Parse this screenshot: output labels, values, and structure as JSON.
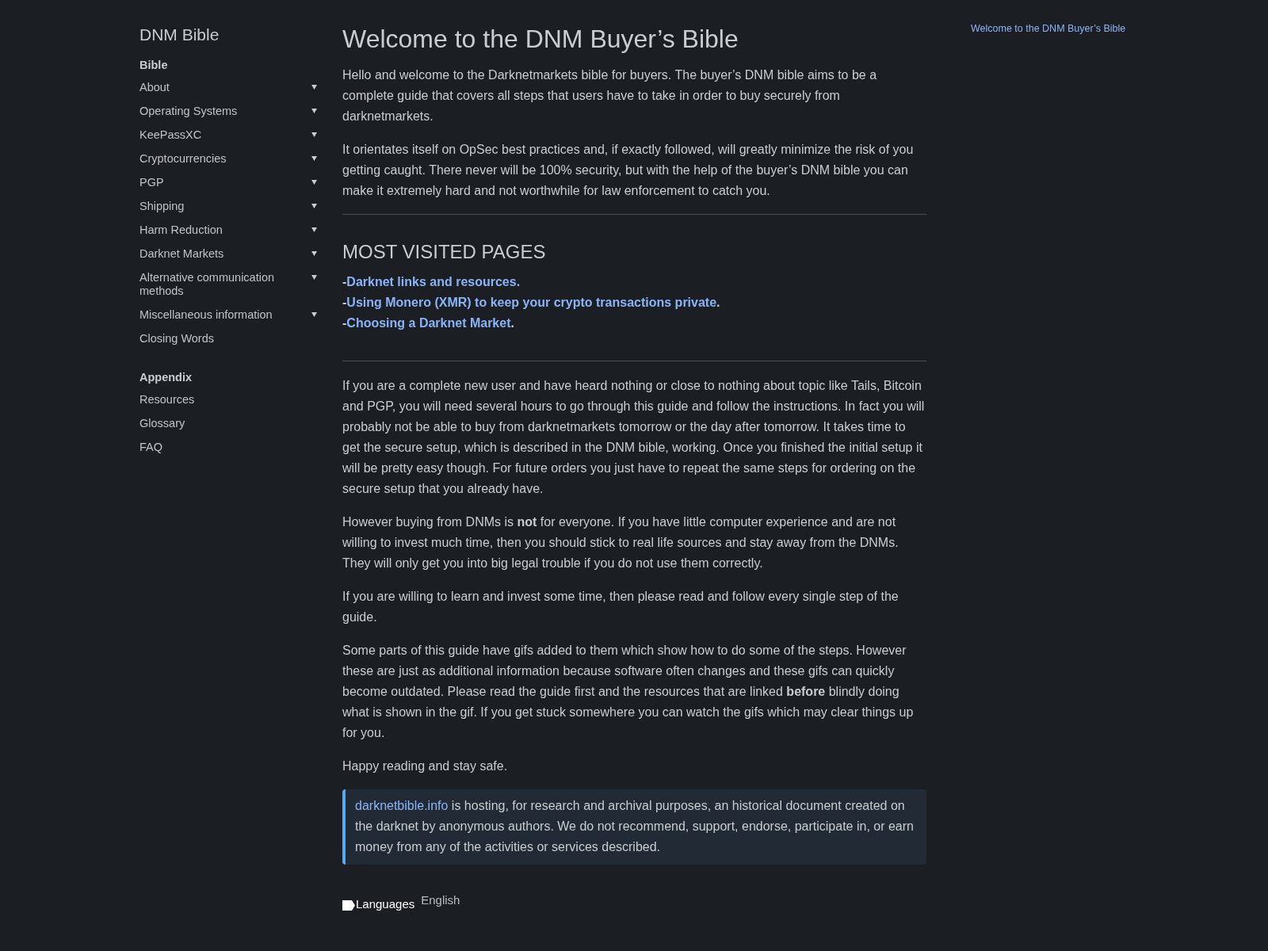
{
  "sidebar": {
    "title": "DNM Bible",
    "sections": [
      {
        "heading": "Bible",
        "items": [
          {
            "label": "About",
            "kind": "group"
          },
          {
            "label": "Operating Systems",
            "kind": "group"
          },
          {
            "label": "KeePassXC",
            "kind": "group"
          },
          {
            "label": "Cryptocurrencies",
            "kind": "group"
          },
          {
            "label": "PGP",
            "kind": "group"
          },
          {
            "label": "Shipping",
            "kind": "group"
          },
          {
            "label": "Harm Reduction",
            "kind": "group"
          },
          {
            "label": "Darknet Markets",
            "kind": "group"
          },
          {
            "label": "Alternative communication methods",
            "kind": "group"
          },
          {
            "label": "Miscellaneous information",
            "kind": "group"
          },
          {
            "label": "Closing Words",
            "kind": "page"
          }
        ]
      },
      {
        "heading": "Appendix",
        "items": [
          {
            "label": "Resources",
            "kind": "page"
          },
          {
            "label": "Glossary",
            "kind": "page"
          },
          {
            "label": "FAQ",
            "kind": "page"
          }
        ]
      }
    ]
  },
  "article": {
    "title": "Welcome to the DNM Buyer’s Bible",
    "intro": [
      "Hello and welcome to the Darknetmarkets bible for buyers. The buyer’s DNM bible aims to be a complete guide that covers all steps that users have to take in order to buy securely from darknetmarkets.",
      "It orientates itself on OpSec best practices and, if exactly followed, will greatly minimize the risk of you getting caught. There never will be 100% security, but with the help of the buyer’s DNM bible you can make it extremely hard and not worthwhile for law enforcement to catch you."
    ],
    "most_visited": {
      "heading": "MOST VISITED PAGES",
      "links": [
        {
          "prefix": "-",
          "link": "Darknet links and resources."
        },
        {
          "prefix": "-",
          "link": "Using Monero (XMR) to keep your crypto transactions private",
          "suffix": "."
        },
        {
          "prefix": "-",
          "link": "Choosing a Darknet Market",
          "suffix": "."
        }
      ]
    },
    "body": [
      "If you are a complete new user and have heard nothing or close to nothing about topic like Tails, Bitcoin and PGP, you will need several hours to go through this guide and follow the instructions. In fact you will probably not be able to buy from darknetmarkets tomorrow or the day after tomorrow. It takes time to get the secure setup, which is described in the DNM bible, working. Once you finished the initial setup it will be pretty easy though. For future orders you just have to repeat the same steps for ordering on the secure setup that you already have.",
      "However buying from DNMs is **not** for everyone. If you have little computer experience and are not willing to invest much time, then you should stick to real life sources and stay away from the DNMs. They will only get you into big legal trouble if you do not use them correctly.",
      "If you are willing to learn and invest some time, then please read and follow every single step of the guide.",
      "Some parts of this guide have gifs added to them which show how to do some of the steps. However these are just as additional information because software often changes and these gifs can quickly become outdated. Please read the guide first and the resources that are linked **before** blindly doing what is shown in the gif. If you get stuck somewhere you can watch the gifs which may clear things up for you.",
      "Happy reading and stay safe."
    ],
    "notice": {
      "link": "darknetbible.info",
      "text": " is hosting, for research and archival purposes, an historical document created on the darknet by anonymous authors. We do not recommend, support, endorse, participate in, or earn money from any of the activities or services described."
    },
    "languages": {
      "label": "Languages",
      "value": "English"
    }
  },
  "toc": {
    "items": [
      "Welcome to the DNM Buyer’s Bible"
    ]
  }
}
